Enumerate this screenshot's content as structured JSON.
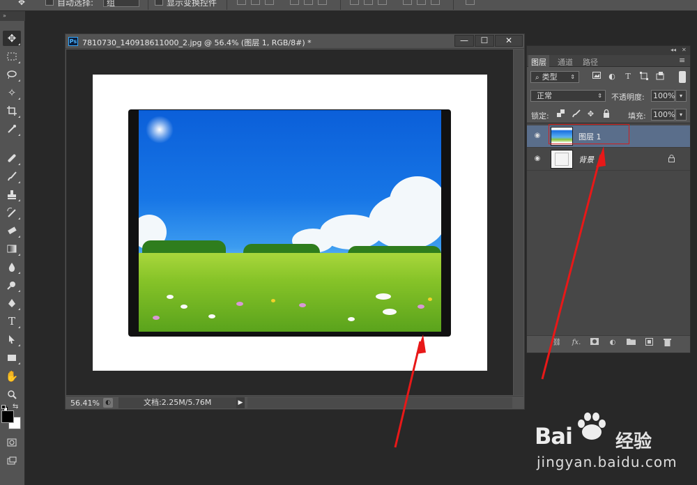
{
  "options_bar": {
    "auto_select_label": "自动选择:",
    "auto_select_value": "组",
    "show_transform_label": "显示变换控件"
  },
  "tools": {
    "toolbar_grip": "»"
  },
  "document": {
    "title": "7810730_140918611000_2.jpg @ 56.4% (图层 1, RGB/8#) *",
    "ps_badge": "Ps",
    "minimize": "—",
    "maximize": "☐",
    "close": "✕",
    "zoom": "56.41%",
    "doc_info": "文档:2.25M/5.76M",
    "status_arrow": "▶"
  },
  "layers_panel": {
    "collapse": "◂◂",
    "close": "✕",
    "menu": "≡",
    "tabs": [
      "图层",
      "通道",
      "路径"
    ],
    "active_tab": 0,
    "filter_label": "类型",
    "blend_mode": "正常",
    "opacity_label": "不透明度:",
    "opacity_value": "100%",
    "lock_label": "锁定:",
    "fill_label": "填充:",
    "fill_value": "100%",
    "layers": [
      {
        "name": "图层 1",
        "selected": true,
        "visible": true,
        "locked": false
      },
      {
        "name": "背景",
        "selected": false,
        "visible": true,
        "locked": true
      }
    ],
    "footer_icons": [
      "link-icon",
      "fx-icon",
      "mask-icon",
      "adjustment-icon",
      "group-icon",
      "new-layer-icon",
      "trash-icon"
    ],
    "footer_fx": "fx."
  },
  "watermark": {
    "brand": "Bai",
    "brand_suffix": "经验",
    "url": "jingyan.baidu.com"
  },
  "colors": {
    "app_bg": "#282828",
    "panel_bg": "#535353",
    "selected_layer": "#5a6e8b",
    "annotation_red": "#e81818"
  }
}
